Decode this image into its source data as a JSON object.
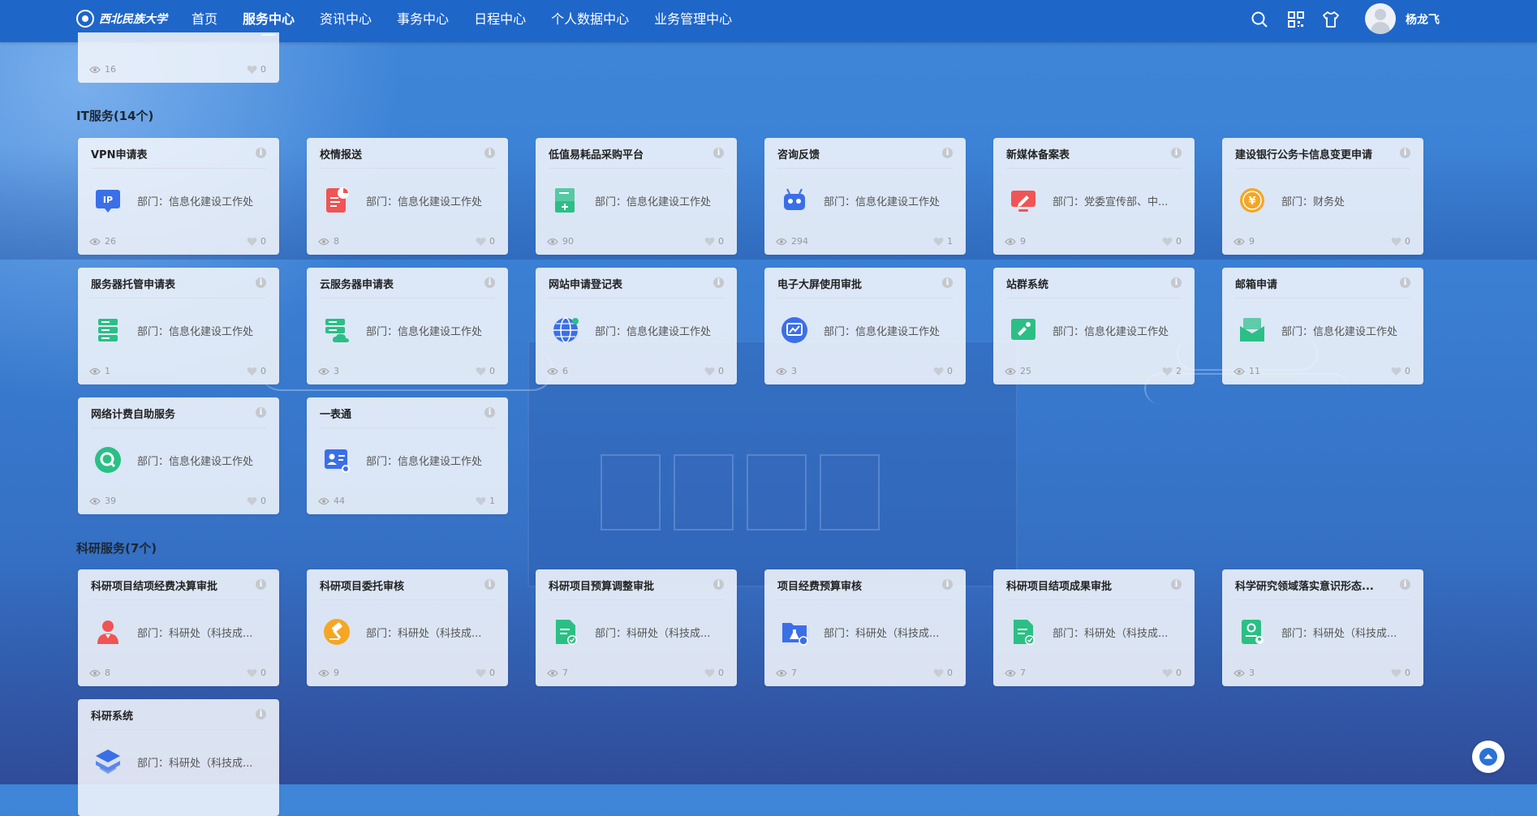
{
  "header": {
    "logo_text": "西北民族大学",
    "nav": [
      "首页",
      "服务中心",
      "资讯中心",
      "事务中心",
      "日程中心",
      "个人数据中心",
      "业务管理中心"
    ],
    "active_nav": "服务中心",
    "username": "杨龙飞"
  },
  "partial_card": {
    "views": "16",
    "likes": "0"
  },
  "sections": [
    {
      "title": "IT服务(14个)",
      "cards": [
        {
          "title": "VPN申请表",
          "dept": "部门：信息化建设工作处",
          "views": "26",
          "likes": "0",
          "icon": "ip-icon",
          "color": "#3b6fe8"
        },
        {
          "title": "校情报送",
          "dept": "部门：信息化建设工作处",
          "views": "8",
          "likes": "0",
          "icon": "report-chart-icon",
          "color": "#f05454"
        },
        {
          "title": "低值易耗品采购平台",
          "dept": "部门：信息化建设工作处",
          "views": "90",
          "likes": "0",
          "icon": "purchase-icon",
          "color": "#2bbf86"
        },
        {
          "title": "咨询反馈",
          "dept": "部门：信息化建设工作处",
          "views": "294",
          "likes": "1",
          "icon": "robot-icon",
          "color": "#3b6fe8"
        },
        {
          "title": "新媒体备案表",
          "dept": "部门：党委宣传部、中...",
          "views": "9",
          "likes": "0",
          "icon": "media-pen-icon",
          "color": "#f05454"
        },
        {
          "title": "建设银行公务卡信息变更申请",
          "dept": "部门：财务处",
          "views": "9",
          "likes": "0",
          "icon": "yuan-coin-icon",
          "color": "#f5a623"
        },
        {
          "title": "服务器托管申请表",
          "dept": "部门：信息化建设工作处",
          "views": "1",
          "likes": "0",
          "icon": "server-icon",
          "color": "#2bbf86"
        },
        {
          "title": "云服务器申请表",
          "dept": "部门：信息化建设工作处",
          "views": "3",
          "likes": "0",
          "icon": "cloud-server-icon",
          "color": "#2bbf86"
        },
        {
          "title": "网站申请登记表",
          "dept": "部门：信息化建设工作处",
          "views": "6",
          "likes": "0",
          "icon": "globe-icon",
          "color": "#3b6fe8"
        },
        {
          "title": "电子大屏使用审批",
          "dept": "部门：信息化建设工作处",
          "views": "3",
          "likes": "0",
          "icon": "screen-chart-icon",
          "color": "#3b6fe8"
        },
        {
          "title": "站群系统",
          "dept": "部门：信息化建设工作处",
          "views": "25",
          "likes": "2",
          "icon": "site-group-icon",
          "color": "#2bbf86"
        },
        {
          "title": "邮箱申请",
          "dept": "部门：信息化建设工作处",
          "views": "11",
          "likes": "0",
          "icon": "mailbox-icon",
          "color": "#2bbf86"
        },
        {
          "title": "网络计费自助服务",
          "dept": "部门：信息化建设工作处",
          "views": "39",
          "likes": "0",
          "icon": "network-billing-icon",
          "color": "#2bbf86"
        },
        {
          "title": "一表通",
          "dept": "部门：信息化建设工作处",
          "views": "44",
          "likes": "1",
          "icon": "id-card-icon",
          "color": "#3b6fe8"
        }
      ]
    },
    {
      "title": "科研服务(7个)",
      "cards": [
        {
          "title": "科研项目结项经费决算审批",
          "dept": "部门：科研处（科技成...",
          "views": "8",
          "likes": "0",
          "icon": "person-icon",
          "color": "#f05454"
        },
        {
          "title": "科研项目委托审核",
          "dept": "部门：科研处（科技成...",
          "views": "9",
          "likes": "0",
          "icon": "gavel-icon",
          "color": "#f5a623"
        },
        {
          "title": "科研项目预算调整审批",
          "dept": "部门：科研处（科技成...",
          "views": "7",
          "likes": "0",
          "icon": "doc-check-icon",
          "color": "#2bbf86"
        },
        {
          "title": "项目经费预算审核",
          "dept": "部门：科研处（科技成...",
          "views": "7",
          "likes": "0",
          "icon": "folder-flask-icon",
          "color": "#3b6fe8"
        },
        {
          "title": "科研项目结项成果审批",
          "dept": "部门：科研处（科技成...",
          "views": "7",
          "likes": "0",
          "icon": "doc-check-icon",
          "color": "#2bbf86"
        },
        {
          "title": "科学研究领域落实意识形态...",
          "dept": "部门：科研处（科技成...",
          "views": "3",
          "likes": "0",
          "icon": "certificate-icon",
          "color": "#2bbf86"
        },
        {
          "title": "科研系统",
          "dept": "部门：科研处（科技成...",
          "views": "",
          "likes": "",
          "icon": "layers-icon",
          "color": "#3b6fe8"
        }
      ]
    }
  ]
}
